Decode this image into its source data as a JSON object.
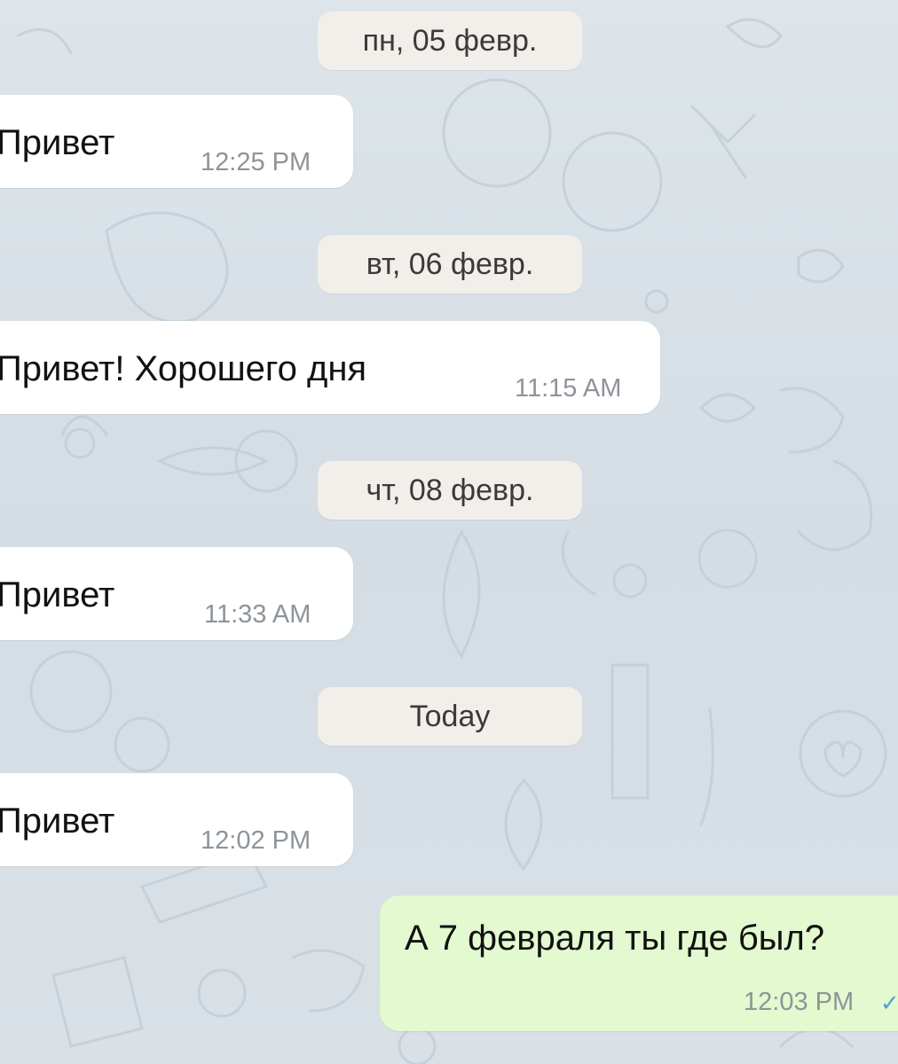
{
  "messages": [
    {
      "type": "date",
      "label": "пн, 05 февр."
    },
    {
      "type": "incoming",
      "text": "Привет",
      "time": "12:25 PM"
    },
    {
      "type": "date",
      "label": "вт, 06 февр."
    },
    {
      "type": "incoming",
      "text": "Привет! Хорошего дня",
      "time": "11:15 AM"
    },
    {
      "type": "date",
      "label": "чт, 08 февр."
    },
    {
      "type": "incoming",
      "text": "Привет",
      "time": "11:33 AM"
    },
    {
      "type": "date",
      "label": "Today"
    },
    {
      "type": "incoming",
      "text": "Привет",
      "time": "12:02 PM"
    },
    {
      "type": "outgoing",
      "text": "А 7 февраля ты где был?",
      "time": "12:03 PM",
      "status_icon": "single-check-icon"
    }
  ],
  "colors": {
    "background": "#d7e0e6",
    "date_pill": "#f2efea",
    "incoming_bubble": "#ffffff",
    "outgoing_bubble": "#e3f9cf",
    "timestamp": "#8e9499",
    "check": "#55a0d4"
  }
}
